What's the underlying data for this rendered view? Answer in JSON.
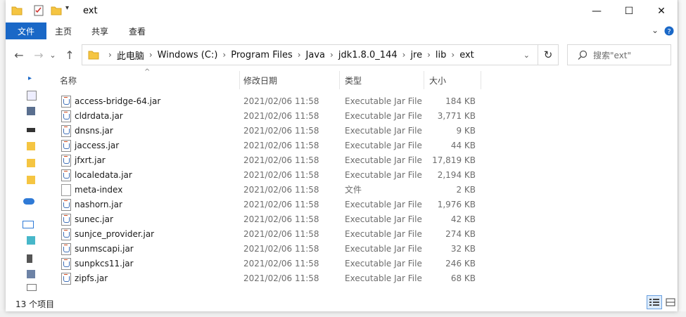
{
  "window": {
    "title": "ext"
  },
  "titlebar": {
    "minimize_glyph": "—",
    "maximize_glyph": "☐",
    "close_glyph": "✕"
  },
  "ribbon": {
    "file_tab": "文件",
    "tabs": [
      "主页",
      "共享",
      "查看"
    ]
  },
  "nav": {
    "back_glyph": "←",
    "forward_glyph": "→",
    "recent_glyph": "⌄",
    "up_glyph": "↑",
    "breadcrumbs": [
      "此电脑",
      "Windows (C:)",
      "Program Files",
      "Java",
      "jdk1.8.0_144",
      "jre",
      "lib",
      "ext"
    ],
    "breadcrumb_sep": "›",
    "dropdown_glyph": "⌄",
    "refresh_glyph": "↻",
    "search_placeholder": "搜索\"ext\""
  },
  "columns": {
    "name": "名称",
    "date": "修改日期",
    "type": "类型",
    "size": "大小"
  },
  "files": [
    {
      "name": "access-bridge-64.jar",
      "date": "2021/02/06 11:58",
      "type": "Executable Jar File",
      "size": "184 KB",
      "icon": "jar-icon"
    },
    {
      "name": "cldrdata.jar",
      "date": "2021/02/06 11:58",
      "type": "Executable Jar File",
      "size": "3,771 KB",
      "icon": "jar-icon"
    },
    {
      "name": "dnsns.jar",
      "date": "2021/02/06 11:58",
      "type": "Executable Jar File",
      "size": "9 KB",
      "icon": "jar-icon"
    },
    {
      "name": "jaccess.jar",
      "date": "2021/02/06 11:58",
      "type": "Executable Jar File",
      "size": "44 KB",
      "icon": "jar-icon"
    },
    {
      "name": "jfxrt.jar",
      "date": "2021/02/06 11:58",
      "type": "Executable Jar File",
      "size": "17,819 KB",
      "icon": "jar-icon"
    },
    {
      "name": "localedata.jar",
      "date": "2021/02/06 11:58",
      "type": "Executable Jar File",
      "size": "2,194 KB",
      "icon": "jar-icon"
    },
    {
      "name": "meta-index",
      "date": "2021/02/06 11:58",
      "type": "文件",
      "size": "2 KB",
      "icon": "file-icon"
    },
    {
      "name": "nashorn.jar",
      "date": "2021/02/06 11:58",
      "type": "Executable Jar File",
      "size": "1,976 KB",
      "icon": "jar-icon"
    },
    {
      "name": "sunec.jar",
      "date": "2021/02/06 11:58",
      "type": "Executable Jar File",
      "size": "42 KB",
      "icon": "jar-icon"
    },
    {
      "name": "sunjce_provider.jar",
      "date": "2021/02/06 11:58",
      "type": "Executable Jar File",
      "size": "274 KB",
      "icon": "jar-icon"
    },
    {
      "name": "sunmscapi.jar",
      "date": "2021/02/06 11:58",
      "type": "Executable Jar File",
      "size": "32 KB",
      "icon": "jar-icon"
    },
    {
      "name": "sunpkcs11.jar",
      "date": "2021/02/06 11:58",
      "type": "Executable Jar File",
      "size": "246 KB",
      "icon": "jar-icon"
    },
    {
      "name": "zipfs.jar",
      "date": "2021/02/06 11:58",
      "type": "Executable Jar File",
      "size": "68 KB",
      "icon": "jar-icon"
    }
  ],
  "status": {
    "item_count": "13 个项目"
  },
  "colors": {
    "accent": "#1a68c7",
    "folder": "#f5c542"
  }
}
